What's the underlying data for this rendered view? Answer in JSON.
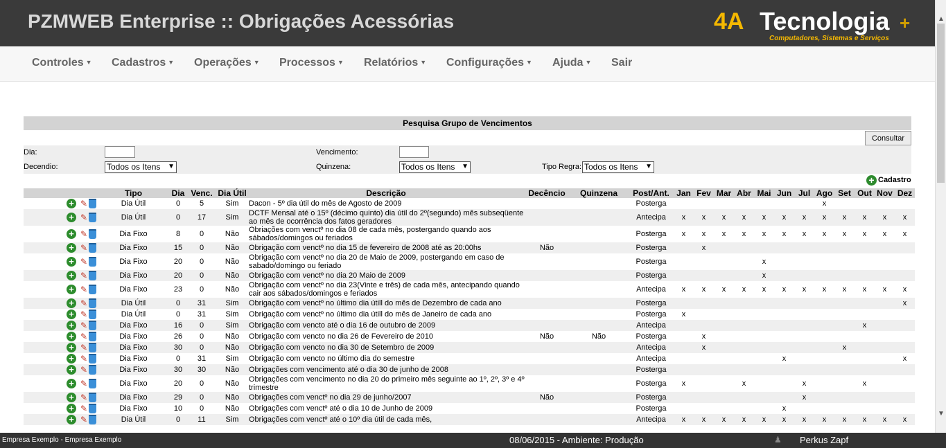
{
  "header": {
    "title": "PZMWEB Enterprise :: Obrigações Acessórias",
    "logo": {
      "brand_4a": "4A",
      "brand_name": "Tecnologia",
      "tagline": "Computadores, Sistemas e Serviços"
    }
  },
  "menu": [
    {
      "label": "Controles",
      "has_dropdown": true
    },
    {
      "label": "Cadastros",
      "has_dropdown": true
    },
    {
      "label": "Operações",
      "has_dropdown": true
    },
    {
      "label": "Processos",
      "has_dropdown": true
    },
    {
      "label": "Relatórios",
      "has_dropdown": true
    },
    {
      "label": "Configurações",
      "has_dropdown": true
    },
    {
      "label": "Ajuda",
      "has_dropdown": true
    },
    {
      "label": "Sair",
      "has_dropdown": false
    }
  ],
  "search": {
    "title": "Pesquisa Grupo de Vencimentos",
    "consultar_label": "Consultar",
    "dia_label": "Dia:",
    "dia_value": "",
    "vencimento_label": "Vencimento:",
    "vencimento_value": "",
    "decendio_label": "Decendio:",
    "decendio_value": "Todos os Itens",
    "quinzena_label": "Quinzena:",
    "quinzena_value": "Todos os Itens",
    "tipo_regra_label": "Tipo Regra:",
    "tipo_regra_value": "Todos os Itens",
    "cadastro_label": "Cadastro"
  },
  "table": {
    "columns": [
      "Tipo",
      "Dia",
      "Venc.",
      "Dia Útil",
      "Descrição",
      "Decêncio",
      "Quinzena",
      "Post/Ant.",
      "Jan",
      "Fev",
      "Mar",
      "Abr",
      "Mai",
      "Jun",
      "Jul",
      "Ago",
      "Set",
      "Out",
      "Nov",
      "Dez"
    ],
    "rows": [
      {
        "tipo": "Dia Útil",
        "dia": "0",
        "venc": "5",
        "util": "Sim",
        "desc": "Dacon - 5º dia útil do mês de Agosto de 2009",
        "dec": "",
        "quin": "",
        "post": "Posterga",
        "m": [
          "",
          "",
          "",
          "",
          "",
          "",
          "",
          "x",
          "",
          "",
          "",
          ""
        ]
      },
      {
        "tipo": "Dia Útil",
        "dia": "0",
        "venc": "17",
        "util": "Sim",
        "desc": "DCTF Mensal até o 15º (décimo quinto) dia útil do 2º(segundo) mês subseqüente ao mês de ocorrência dos fatos geradores",
        "dec": "",
        "quin": "",
        "post": "Antecipa",
        "m": [
          "x",
          "x",
          "x",
          "x",
          "x",
          "x",
          "x",
          "x",
          "x",
          "x",
          "x",
          "x"
        ]
      },
      {
        "tipo": "Dia Fixo",
        "dia": "8",
        "venc": "0",
        "util": "Não",
        "desc": "Obriações com venctº no dia 08 de cada mês, postergando quando aos sábados/domingos ou feriados",
        "dec": "",
        "quin": "",
        "post": "Posterga",
        "m": [
          "x",
          "x",
          "x",
          "x",
          "x",
          "x",
          "x",
          "x",
          "x",
          "x",
          "x",
          "x"
        ]
      },
      {
        "tipo": "Dia Fixo",
        "dia": "15",
        "venc": "0",
        "util": "Não",
        "desc": "Obrigação com venctº no dia 15 de fevereiro de 2008 até as 20:00hs",
        "dec": "Não",
        "quin": "",
        "post": "Posterga",
        "m": [
          "",
          "x",
          "",
          "",
          "",
          "",
          "",
          "",
          "",
          "",
          "",
          ""
        ]
      },
      {
        "tipo": "Dia Fixo",
        "dia": "20",
        "venc": "0",
        "util": "Não",
        "desc": "Obrigação com venctº no dia 20 de Maio de 2009, postergando em caso de sabado/domingo ou feriado",
        "dec": "",
        "quin": "",
        "post": "Posterga",
        "m": [
          "",
          "",
          "",
          "",
          "x",
          "",
          "",
          "",
          "",
          "",
          "",
          ""
        ]
      },
      {
        "tipo": "Dia Fixo",
        "dia": "20",
        "venc": "0",
        "util": "Não",
        "desc": "Obrigação com venctº no dia 20 Maio de 2009",
        "dec": "",
        "quin": "",
        "post": "Posterga",
        "m": [
          "",
          "",
          "",
          "",
          "x",
          "",
          "",
          "",
          "",
          "",
          "",
          ""
        ]
      },
      {
        "tipo": "Dia Fixo",
        "dia": "23",
        "venc": "0",
        "util": "Não",
        "desc": "Obrigação com venctº no dia 23(Vinte e três) de cada mês, antecipando quando cair aos sábados/domingos e feriados",
        "dec": "",
        "quin": "",
        "post": "Antecipa",
        "m": [
          "x",
          "x",
          "x",
          "x",
          "x",
          "x",
          "x",
          "x",
          "x",
          "x",
          "x",
          "x"
        ]
      },
      {
        "tipo": "Dia Útil",
        "dia": "0",
        "venc": "31",
        "util": "Sim",
        "desc": "Obrigação com venctº no último dia útill do mês de Dezembro de cada ano",
        "dec": "",
        "quin": "",
        "post": "Posterga",
        "m": [
          "",
          "",
          "",
          "",
          "",
          "",
          "",
          "",
          "",
          "",
          "",
          "x"
        ]
      },
      {
        "tipo": "Dia Útil",
        "dia": "0",
        "venc": "31",
        "util": "Sim",
        "desc": "Obrigação com venctº no último dia útill do mês de Janeiro de cada ano",
        "dec": "",
        "quin": "",
        "post": "Posterga",
        "m": [
          "x",
          "",
          "",
          "",
          "",
          "",
          "",
          "",
          "",
          "",
          "",
          ""
        ]
      },
      {
        "tipo": "Dia Fixo",
        "dia": "16",
        "venc": "0",
        "util": "Sim",
        "desc": "Obrigação com vencto até o dia 16 de outubro de 2009",
        "dec": "",
        "quin": "",
        "post": "Antecipa",
        "m": [
          "",
          "",
          "",
          "",
          "",
          "",
          "",
          "",
          "",
          "x",
          "",
          ""
        ]
      },
      {
        "tipo": "Dia Fixo",
        "dia": "26",
        "venc": "0",
        "util": "Não",
        "desc": "Obrigação com vencto no dia 26 de Fevereiro de 2010",
        "dec": "Não",
        "quin": "Não",
        "post": "Posterga",
        "m": [
          "",
          "x",
          "",
          "",
          "",
          "",
          "",
          "",
          "",
          "",
          "",
          ""
        ]
      },
      {
        "tipo": "Dia Fixo",
        "dia": "30",
        "venc": "0",
        "util": "Não",
        "desc": "Obrigação com vencto no dia 30 de Setembro de 2009",
        "dec": "",
        "quin": "",
        "post": "Antecipa",
        "m": [
          "",
          "x",
          "",
          "",
          "",
          "",
          "",
          "",
          "x",
          "",
          "",
          ""
        ]
      },
      {
        "tipo": "Dia Fixo",
        "dia": "0",
        "venc": "31",
        "util": "Sim",
        "desc": "Obrigação com vencto no último dia do semestre",
        "dec": "",
        "quin": "",
        "post": "Antecipa",
        "m": [
          "",
          "",
          "",
          "",
          "",
          "x",
          "",
          "",
          "",
          "",
          "",
          "x"
        ]
      },
      {
        "tipo": "Dia Fixo",
        "dia": "30",
        "venc": "30",
        "util": "Não",
        "desc": "Obrigações com vencimento até o dia 30 de junho de 2008",
        "dec": "",
        "quin": "",
        "post": "Posterga",
        "m": [
          "",
          "",
          "",
          "",
          "",
          "",
          "",
          "",
          "",
          "",
          "",
          ""
        ]
      },
      {
        "tipo": "Dia Fixo",
        "dia": "20",
        "venc": "0",
        "util": "Não",
        "desc": "Obrigações com vencimento no dia 20 do primeiro mês seguinte ao 1º, 2º, 3º e 4º trimestre",
        "dec": "",
        "quin": "",
        "post": "Posterga",
        "m": [
          "x",
          "",
          "",
          "x",
          "",
          "",
          "x",
          "",
          "",
          "x",
          "",
          ""
        ]
      },
      {
        "tipo": "Dia Fixo",
        "dia": "29",
        "venc": "0",
        "util": "Não",
        "desc": "Obrigações com venctº no dia 29 de junho/2007",
        "dec": "Não",
        "quin": "",
        "post": "Posterga",
        "m": [
          "",
          "",
          "",
          "",
          "",
          "",
          "x",
          "",
          "",
          "",
          "",
          ""
        ]
      },
      {
        "tipo": "Dia Fixo",
        "dia": "10",
        "venc": "0",
        "util": "Não",
        "desc": "Obrigações com venctº até o dia 10 de Junho de 2009",
        "dec": "",
        "quin": "",
        "post": "Posterga",
        "m": [
          "",
          "",
          "",
          "",
          "",
          "x",
          "",
          "",
          "",
          "",
          "",
          ""
        ]
      },
      {
        "tipo": "Dia Útil",
        "dia": "0",
        "venc": "11",
        "util": "Sim",
        "desc": "Obrigações com venctº até o 10º dia útil de cada mês,",
        "dec": "",
        "quin": "",
        "post": "Antecipa",
        "m": [
          "x",
          "x",
          "x",
          "x",
          "x",
          "x",
          "x",
          "x",
          "x",
          "x",
          "x",
          "x"
        ]
      }
    ]
  },
  "footer": {
    "company": "Empresa Exemplo - Empresa Exemplo",
    "status": "08/06/2015 - Ambiente: Produção",
    "user": "Perkus Zapf"
  }
}
